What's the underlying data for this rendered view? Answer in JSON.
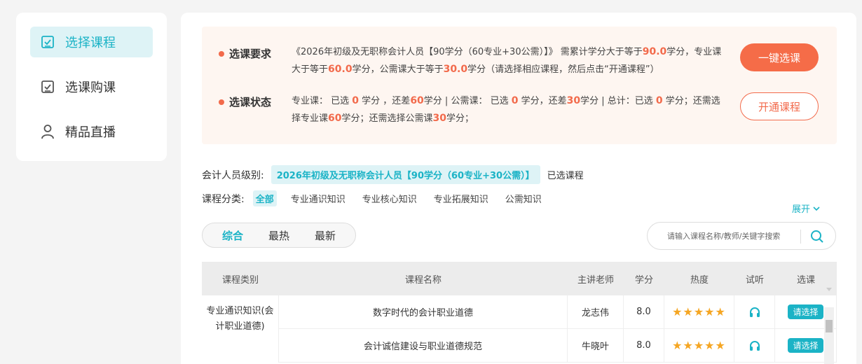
{
  "sidebar": {
    "items": [
      {
        "label": "选择课程",
        "icon": "check-square-icon",
        "active": true
      },
      {
        "label": "选课购课",
        "icon": "check-square-icon",
        "active": false
      },
      {
        "label": "精品直播",
        "icon": "user-icon",
        "active": false
      }
    ]
  },
  "notice": {
    "req_label": "选课要求",
    "req_text_a": "《2026年初级及无职称会计人员【90学分（60专业+30公需）】》 需累计学分大于等于",
    "req_total": "90.0",
    "req_text_b": "学分，专业课大于等于",
    "req_prof": "60.0",
    "req_text_c": "学分，公需课大于等于",
    "req_public": "30.0",
    "req_text_d": "学分（请选择相应课程，然后点击“开通课程”）",
    "status_label": "选课状态",
    "st_a": "专业课： 已选",
    "st_prof_sel": "0",
    "st_b": "学分 ，还差",
    "st_prof_left": "60",
    "st_c": "学分 | 公需课： 已选",
    "st_pub_sel": "0",
    "st_d": "学分，还差",
    "st_pub_left": "30",
    "st_e": "学分 | 总计：已选",
    "st_total_sel": "0",
    "st_f": "学分；还需选择专业课",
    "st_prof_need": "60",
    "st_g": "学分；还需选择公需课",
    "st_pub_need": "30",
    "st_h": "学分；",
    "one_click_label": "一键选课",
    "open_label": "开通课程"
  },
  "filters": {
    "level_label": "会计人员级别:",
    "level_value": "2026年初级及无职称会计人员【90学分（60专业+30公需）】",
    "selected_label": "已选课程",
    "category_label": "课程分类:",
    "categories": [
      "全部",
      "专业通识知识",
      "专业核心知识",
      "专业拓展知识",
      "公需知识"
    ],
    "expand_label": "展开"
  },
  "sort": {
    "items": [
      "综合",
      "最热",
      "最新"
    ],
    "active": 0
  },
  "search": {
    "placeholder": "请输入课程名称/教师/关键字搜索"
  },
  "table": {
    "headers": [
      "课程类别",
      "课程名称",
      "主讲老师",
      "学分",
      "热度",
      "试听",
      "选课"
    ],
    "category_cell": "专业通识知识(会计职业道德)",
    "rows": [
      {
        "name": "数字时代的会计职业道德",
        "teacher": "龙志伟",
        "credit": "8.0",
        "stars": 5,
        "action": "请选择"
      },
      {
        "name": "会计诚信建设与职业道德规范",
        "teacher": "牛晓叶",
        "credit": "8.0",
        "stars": 5,
        "action": "请选择"
      }
    ]
  },
  "colors": {
    "accent": "#1bb3c6",
    "orange": "#f26a4b",
    "star": "#f5a623"
  }
}
